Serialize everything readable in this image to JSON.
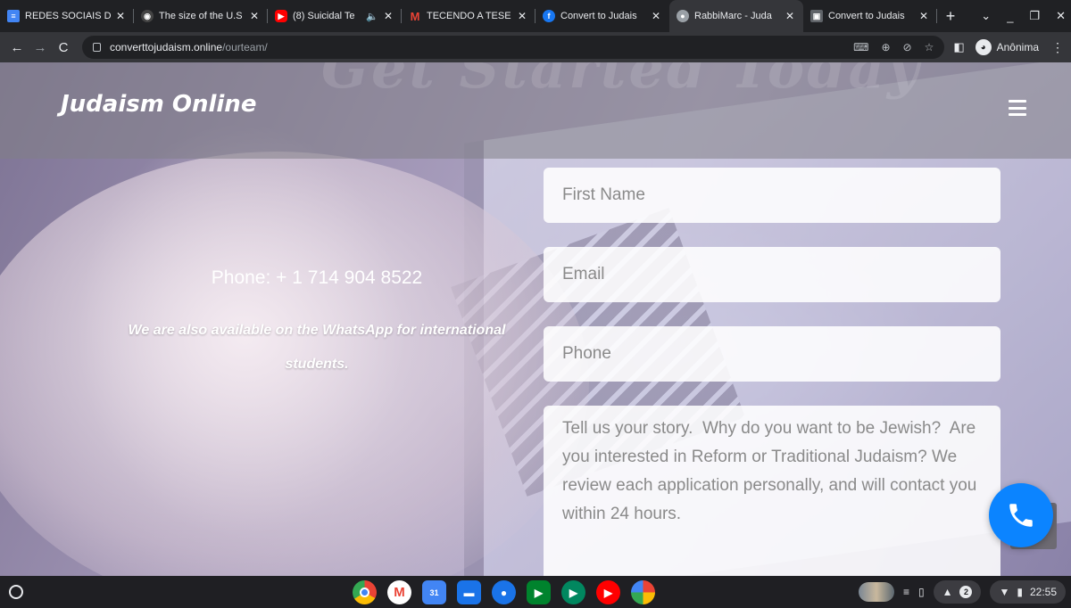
{
  "browser": {
    "tabs": [
      {
        "title": "REDES SOCIAIS DI",
        "favicon": "docs-icon",
        "color": "#4285f4"
      },
      {
        "title": "The size of the U.S",
        "favicon": "globe-icon",
        "color": "#444444"
      },
      {
        "title": "(8) Suicidal Te",
        "favicon": "youtube-icon",
        "color": "#ff0000",
        "audio": true
      },
      {
        "title": "TECENDO A TESE",
        "favicon": "gmail-icon",
        "color": "#ea4335"
      },
      {
        "title": "Convert to Judais",
        "favicon": "facebook-icon",
        "color": "#1877f2"
      },
      {
        "title": "RabbiMarc - Juda",
        "favicon": "profile-icon",
        "color": "#9aa0a6",
        "active": true
      },
      {
        "title": "Convert to Judais",
        "favicon": "site-icon",
        "color": "#5f6368"
      }
    ],
    "url_host": "converttojudaism.online",
    "url_path": "/ourteam/",
    "profile_label": "Anônima"
  },
  "site": {
    "ghost_heading": "Get Started Today",
    "logo": "Judaism Online",
    "phone": "Phone: + 1 714 904 8522",
    "whatsapp_note": "We are also available on the WhatsApp for international students.",
    "form": {
      "first_name_placeholder": "First Name",
      "email_placeholder": "Email",
      "phone_placeholder": "Phone",
      "story_placeholder": "Tell us your story.  Why do you want to be Jewish?  Are you interested in Reform or Traditional Judaism? We review each application personally, and will contact you within 24 hours."
    },
    "colors": {
      "call_button": "#0b84ff"
    }
  },
  "shelf": {
    "apps": [
      "chrome-icon",
      "gmail-icon",
      "calendar-icon",
      "files-icon",
      "messages-icon",
      "meet-icon",
      "play-store-icon",
      "youtube-icon",
      "photos-icon"
    ],
    "notification_count": "2",
    "time": "22:55"
  }
}
